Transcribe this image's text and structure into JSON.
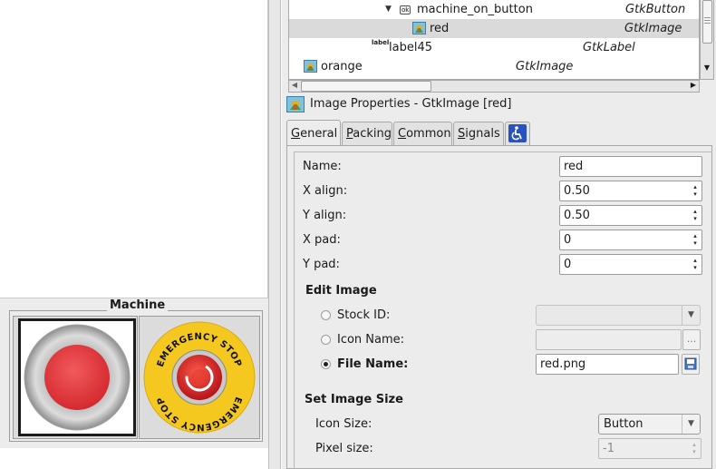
{
  "tree": {
    "rows": [
      {
        "name": "machine_on_button",
        "type": "GtkButton",
        "badge": "ok"
      },
      {
        "name": "red",
        "type": "GtkImage"
      },
      {
        "name": "label45",
        "type": "GtkLabel",
        "badge": "label"
      },
      {
        "name": "orange",
        "type": "GtkImage"
      }
    ]
  },
  "properties": {
    "title": "Image Properties - GtkImage [red]"
  },
  "tabs": [
    {
      "label_first": "G",
      "label_rest": "eneral"
    },
    {
      "label_first": "P",
      "label_rest": "acking"
    },
    {
      "label_first": "C",
      "label_rest": "ommon"
    },
    {
      "label_first": "S",
      "label_rest": "ignals"
    }
  ],
  "general": {
    "name_label": "Name:",
    "name_value": "red",
    "xalign_label": "X align:",
    "xalign_value": "0.50",
    "yalign_label": "Y align:",
    "yalign_value": "0.50",
    "xpad_label": "X pad:",
    "xpad_value": "0",
    "ypad_label": "Y pad:",
    "ypad_value": "0",
    "edit_image_heading": "Edit Image",
    "stock_id_label": "Stock ID:",
    "icon_name_label": "Icon Name:",
    "icon_name_button": "...",
    "file_name_label": "File Name:",
    "file_name_value": "red.png",
    "set_size_heading": "Set Image Size",
    "icon_size_label": "Icon Size:",
    "icon_size_value": "Button",
    "pixel_size_label": "Pixel size:",
    "pixel_size_value": "-1"
  },
  "canvas": {
    "frame_label": "Machine",
    "estop_top_text": "EMERGENCY STOP",
    "estop_bottom_text": "EMERGENCY STOP"
  },
  "colors": {
    "estop_yellow": "#f4c81e",
    "estop_red": "#d21e1e",
    "button_red": "#e0353a"
  }
}
